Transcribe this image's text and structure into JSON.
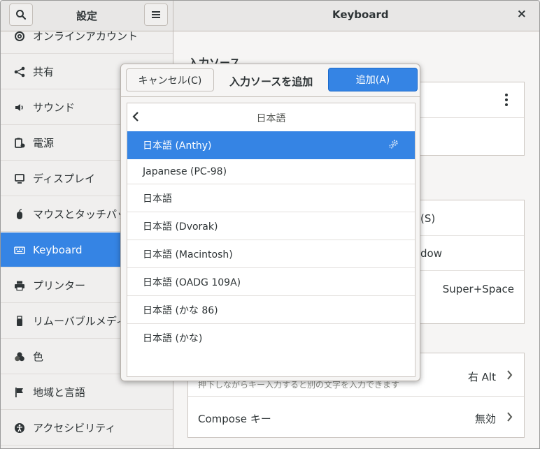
{
  "window": {
    "sidebar_title": "設定",
    "panel_title": "Keyboard",
    "close_glyph": "×",
    "search_icon": "search-icon",
    "menu_icon": "hamburger-icon"
  },
  "sidebar": {
    "items": [
      {
        "label": "オンラインアカウント",
        "icon": "at-icon"
      },
      {
        "label": "共有",
        "icon": "share-icon"
      },
      {
        "label": "サウンド",
        "icon": "speaker-icon"
      },
      {
        "label": "電源",
        "icon": "power-icon"
      },
      {
        "label": "ディスプレイ",
        "icon": "display-icon"
      },
      {
        "label": "マウスとタッチパッド",
        "icon": "mouse-icon"
      },
      {
        "label": "Keyboard",
        "icon": "keyboard-icon",
        "active": true
      },
      {
        "label": "プリンター",
        "icon": "printer-icon"
      },
      {
        "label": "リムーバブルメディア",
        "icon": "usb-icon"
      },
      {
        "label": "色",
        "icon": "color-icon"
      },
      {
        "label": "地域と言語",
        "icon": "flag-icon"
      },
      {
        "label": "アクセシビリティ",
        "icon": "accessibility-icon"
      }
    ]
  },
  "main": {
    "section_title": "入力ソース",
    "shortcut_s": "(S)",
    "window_text": "dow",
    "shortcut_value": "Super+Space",
    "alt_char_hint": "押下しながらキー入力すると別の文字を入力できます",
    "alt_char_value": "右 Alt",
    "compose_label": "Compose キー",
    "compose_value": "無効",
    "kebab_icon": "kebab-menu-icon"
  },
  "dialog": {
    "cancel_label": "キャンセル(C)",
    "title": "入力ソースを追加",
    "add_label": "追加(A)",
    "list_title": "日本語",
    "items": [
      {
        "label": "日本語 (Anthy)",
        "selected": true,
        "icon": "gear-icon"
      },
      {
        "label": "Japanese (PC-98)"
      },
      {
        "label": "日本語"
      },
      {
        "label": "日本語 (Dvorak)"
      },
      {
        "label": "日本語 (Macintosh)"
      },
      {
        "label": "日本語 (OADG 109A)"
      },
      {
        "label": "日本語 (かな 86)"
      },
      {
        "label": "日本語 (かな)"
      }
    ]
  },
  "colors": {
    "accent": "#3584e4"
  }
}
